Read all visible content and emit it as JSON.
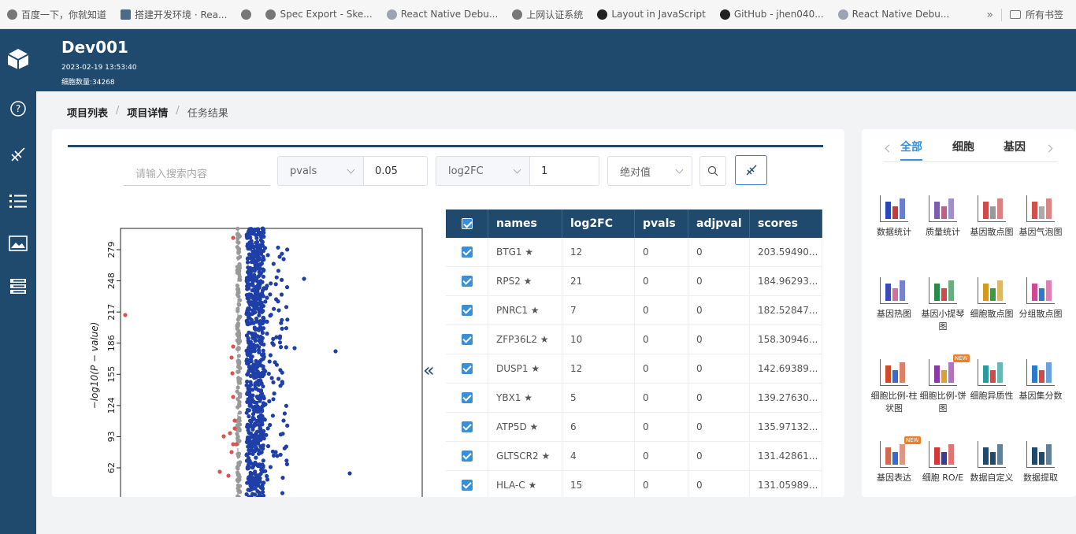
{
  "bookmarks": {
    "items": [
      "百度一下，你就知道",
      "搭建开发环境 · Rea...",
      "",
      "Spec Export - Ske...",
      "React Native Debu...",
      "上网认证系统",
      "Layout in JavaScript",
      "GitHub - jhen040...",
      "React Native Debu..."
    ],
    "overflow": "»",
    "all_bookmarks": "所有书签"
  },
  "header": {
    "title": "Dev001",
    "date": "2023-02-19 13:53:40",
    "cell_count": "细胞数量:34268"
  },
  "breadcrumb": [
    "项目列表",
    "/",
    "项目详情",
    "/",
    "任务结果"
  ],
  "filters": {
    "search_placeholder": "请输入搜索内容",
    "field1": "pvals",
    "value1": "0.05",
    "field2": "log2FC",
    "value2": "1",
    "mode": "绝对值"
  },
  "table": {
    "columns": [
      "names",
      "log2FC",
      "pvals",
      "adjpval",
      "scores"
    ],
    "rows": [
      {
        "name": "BTG1 ★",
        "log2FC": "12",
        "pvals": "0",
        "adjpval": "0",
        "scores": "203.59490..."
      },
      {
        "name": "RPS2 ★",
        "log2FC": "21",
        "pvals": "0",
        "adjpval": "0",
        "scores": "184.96293..."
      },
      {
        "name": "PNRC1 ★",
        "log2FC": "7",
        "pvals": "0",
        "adjpval": "0",
        "scores": "182.52847..."
      },
      {
        "name": "ZFP36L2 ★",
        "log2FC": "10",
        "pvals": "0",
        "adjpval": "0",
        "scores": "158.30946..."
      },
      {
        "name": "DUSP1 ★",
        "log2FC": "12",
        "pvals": "0",
        "adjpval": "0",
        "scores": "142.69389..."
      },
      {
        "name": "YBX1 ★",
        "log2FC": "5",
        "pvals": "0",
        "adjpval": "0",
        "scores": "139.27630..."
      },
      {
        "name": "ATP5D ★",
        "log2FC": "6",
        "pvals": "0",
        "adjpval": "0",
        "scores": "135.97132..."
      },
      {
        "name": "GLTSCR2 ★",
        "log2FC": "4",
        "pvals": "0",
        "adjpval": "0",
        "scores": "131.42861..."
      },
      {
        "name": "HLA-C ★",
        "log2FC": "15",
        "pvals": "0",
        "adjpval": "0",
        "scores": "131.05989..."
      }
    ]
  },
  "tabs": [
    "全部",
    "细胞",
    "基因"
  ],
  "tools": [
    {
      "label": "数据统计"
    },
    {
      "label": "质量统计"
    },
    {
      "label": "基因散点图"
    },
    {
      "label": "基因气泡图"
    },
    {
      "label": "基因热图"
    },
    {
      "label": "基因小提琴图"
    },
    {
      "label": "细胞散点图"
    },
    {
      "label": "分组散点图"
    },
    {
      "label": "细胞比例-柱状图"
    },
    {
      "label": "细胞比例-饼图",
      "tag": "NEW"
    },
    {
      "label": "细胞异质性"
    },
    {
      "label": "基因集分数"
    },
    {
      "label": "基因表达",
      "tag": "NEW"
    },
    {
      "label": "细胞 RO/E"
    },
    {
      "label": "数据自定义"
    },
    {
      "label": "数据提取"
    }
  ],
  "chart_data": {
    "type": "scatter",
    "ylabel": "−log10(P − value)",
    "yticks": [
      62,
      93,
      124,
      155,
      186,
      217,
      248,
      279
    ],
    "colors": {
      "up": "#1f3fa8",
      "down": "#d9534f",
      "ns": "#999999",
      "threshold": "#888888"
    }
  }
}
